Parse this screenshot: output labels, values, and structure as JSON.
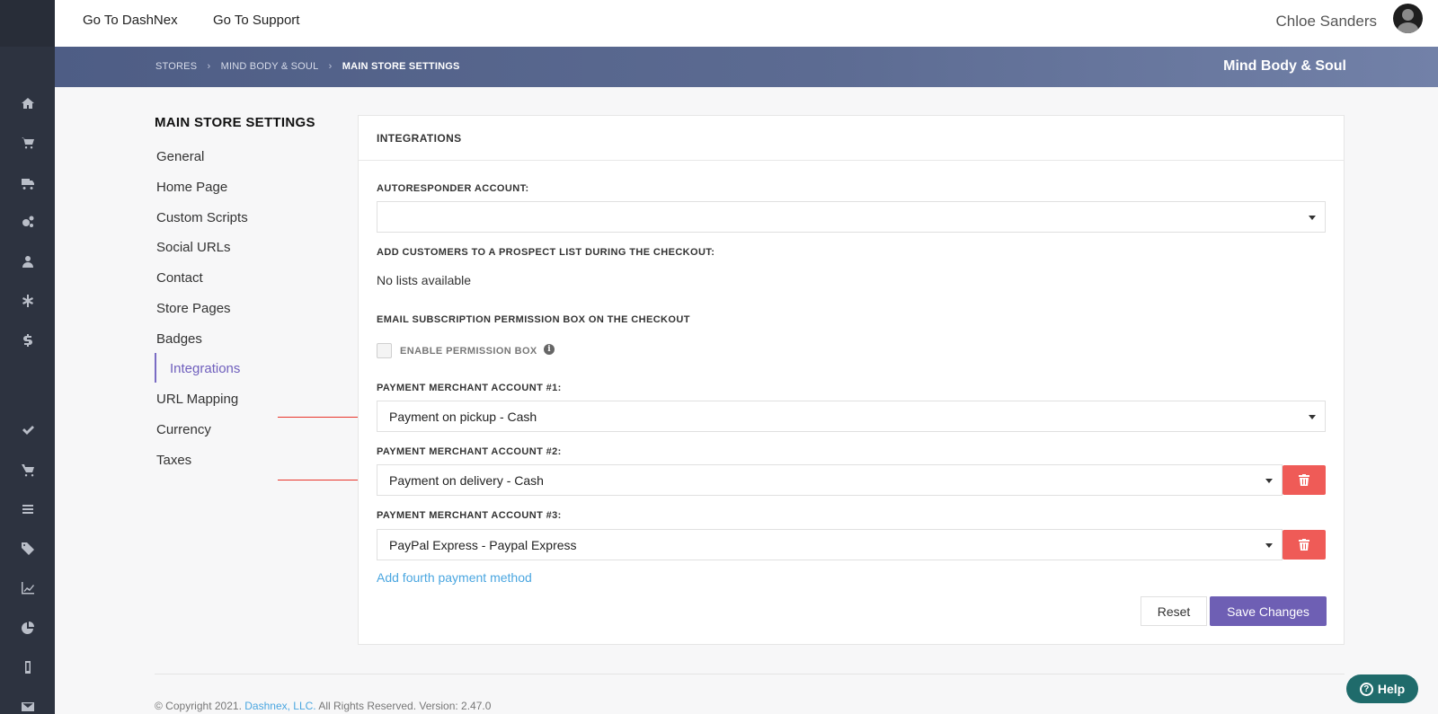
{
  "topbar": {
    "link_dashnex": "Go To DashNex",
    "link_support": "Go To Support",
    "username": "Chloe Sanders"
  },
  "breadcrumb": {
    "items": [
      "STORES",
      "MIND BODY & SOUL",
      "MAIN STORE SETTINGS"
    ],
    "store_name": "Mind Body & Soul"
  },
  "settings_nav": {
    "title": "MAIN STORE SETTINGS",
    "items": [
      "General",
      "Home Page",
      "Custom Scripts",
      "Social URLs",
      "Contact",
      "Store Pages",
      "Badges",
      "Integrations",
      "URL Mapping",
      "Currency",
      "Taxes"
    ],
    "active": "Integrations"
  },
  "sidebar_icons": [
    "home-icon",
    "cart-icon",
    "truck-icon",
    "gears-icon",
    "user-icon",
    "asterisk-icon",
    "dollar-icon",
    "check-icon",
    "shopping-cart-icon",
    "list-icon",
    "tags-icon",
    "line-chart-icon",
    "pie-chart-icon",
    "mobile-icon",
    "envelope-icon"
  ],
  "panel": {
    "title": "INTEGRATIONS",
    "autoresponder_label": "AUTORESPONDER ACCOUNT:",
    "autoresponder_value": "",
    "prospect_label": "ADD CUSTOMERS TO A PROSPECT LIST DURING THE CHECKOUT:",
    "prospect_value": "No lists available",
    "email_label": "EMAIL SUBSCRIPTION PERMISSION BOX ON THE CHECKOUT",
    "enable_label": "ENABLE PERMISSION BOX",
    "merchant1_label": "PAYMENT MERCHANT ACCOUNT #1:",
    "merchant1_value": "Payment on pickup - Cash",
    "merchant2_label": "PAYMENT MERCHANT ACCOUNT #2:",
    "merchant2_value": "Payment on delivery - Cash",
    "merchant3_label": "PAYMENT MERCHANT ACCOUNT #3:",
    "merchant3_value": "PayPal Express - Paypal Express",
    "add_link": "Add fourth payment method",
    "reset_label": "Reset",
    "save_label": "Save Changes"
  },
  "footer": {
    "prefix": "© Copyright 2021.",
    "company": "Dashnex, LLC.",
    "suffix": "All Rights Reserved. Version: 2.47.0"
  },
  "help_label": "Help",
  "colors": {
    "sidebar": "#2d3340",
    "accent": "#6e5fb4",
    "delete": "#ef5b57",
    "link": "#4aa6e0",
    "arrow": "#e8342a"
  }
}
